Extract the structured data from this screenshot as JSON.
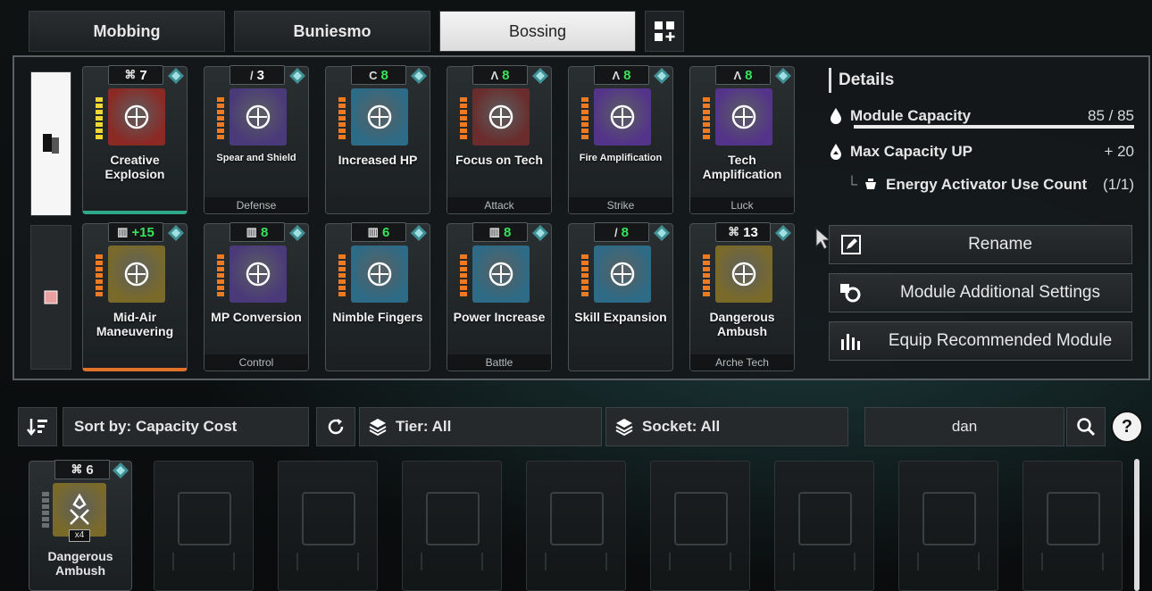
{
  "tabs": [
    {
      "label": "Mobbing"
    },
    {
      "label": "Buniesmo"
    },
    {
      "label": "Bossing"
    }
  ],
  "details": {
    "title": "Details",
    "capacity_label": "Module Capacity",
    "capacity_value": "85 / 85",
    "capacity_fill": 1.0,
    "max_cap_label": "Max Capacity UP",
    "max_cap_value": "+ 20",
    "energy_label": "Energy Activator Use Count",
    "energy_value": "(1/1)",
    "rename": "Rename",
    "additional": "Module Additional Settings",
    "recommended": "Equip Recommended Module"
  },
  "equipped": [
    {
      "name": "Creative Explosion",
      "cost": "7",
      "cost_sym": "⌘",
      "category": "",
      "art": "#8b2a25",
      "bars": "yellow",
      "accent": "teal"
    },
    {
      "name": "Spear and Shield",
      "cost": "3",
      "cost_sym": "/",
      "category": "Defense",
      "art": "#4a3a7a",
      "bars": "orange",
      "small": true
    },
    {
      "name": "Increased HP",
      "cost": "8",
      "cost_sym": "C",
      "category": "",
      "art": "#2d6b86",
      "bars": "orange"
    },
    {
      "name": "Focus on Tech",
      "cost": "8",
      "cost_sym": "Λ",
      "category": "Attack",
      "art": "#6a2c2c",
      "bars": "orange"
    },
    {
      "name": "Fire Amplification",
      "cost": "8",
      "cost_sym": "Λ",
      "category": "Strike",
      "art": "#54348a",
      "bars": "orange",
      "small": true
    },
    {
      "name": "Tech Amplification",
      "cost": "8",
      "cost_sym": "Λ",
      "category": "Luck",
      "art": "#54348a",
      "bars": "orange"
    },
    {
      "name": "Mid-Air Maneuvering",
      "cost": "+15",
      "cost_sym": "▥",
      "category": "",
      "art": "#7a6a2a",
      "bars": "orange",
      "accent": "orange"
    },
    {
      "name": "MP Conversion",
      "cost": "8",
      "cost_sym": "▥",
      "category": "Control",
      "art": "#4a3a7a",
      "bars": "orange"
    },
    {
      "name": "Nimble Fingers",
      "cost": "6",
      "cost_sym": "▥",
      "category": "",
      "art": "#2d6b86",
      "bars": "orange"
    },
    {
      "name": "Power Increase",
      "cost": "8",
      "cost_sym": "▥",
      "category": "Battle",
      "art": "#2d6b86",
      "bars": "orange"
    },
    {
      "name": "Skill Expansion",
      "cost": "8",
      "cost_sym": "/",
      "category": "",
      "art": "#2d6b86",
      "bars": "orange"
    },
    {
      "name": "Dangerous Ambush",
      "cost": "13",
      "cost_sym": "⌘",
      "category": "Arche Tech",
      "art": "#7a6a2a",
      "bars": "orange"
    }
  ],
  "filters": {
    "sort_label": "Sort by: Capacity Cost",
    "tier_label": "Tier: All",
    "socket_label": "Socket: All",
    "search_value": "dan",
    "help": "?"
  },
  "inventory": {
    "card": {
      "name": "Dangerous Ambush",
      "cost": "6",
      "cost_sym": "⌘",
      "qty": "x4",
      "art": "#7a6a2a"
    },
    "empty_slots": 8
  }
}
